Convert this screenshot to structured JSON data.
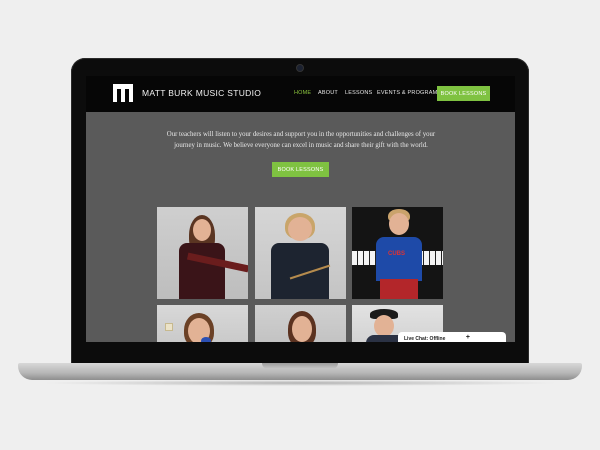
{
  "site": {
    "brand": "MATT BURK MUSIC STUDIO",
    "nav": [
      {
        "label": "HOME",
        "active": true
      },
      {
        "label": "ABOUT",
        "active": false
      },
      {
        "label": "LESSONS",
        "active": false
      },
      {
        "label": "EVENTS & PROGRAMS",
        "active": false
      }
    ],
    "nav_cta": "BOOK LESSONS",
    "intro_line1": "Our teachers will listen to your desires and support you in the opportunities and challenges of your",
    "intro_line2": "journey in music. We believe everyone can excel in music and share their gift with the world.",
    "book_button": "BOOK LESSONS",
    "chat_label": "Live Chat: Offline",
    "chat_icon": "+",
    "shirt_text": "CUBS"
  },
  "colors": {
    "accent": "#7fc241",
    "active_nav": "#8cc63f",
    "page_bg": "#5a5a5a",
    "nav_bg": "#060606"
  }
}
